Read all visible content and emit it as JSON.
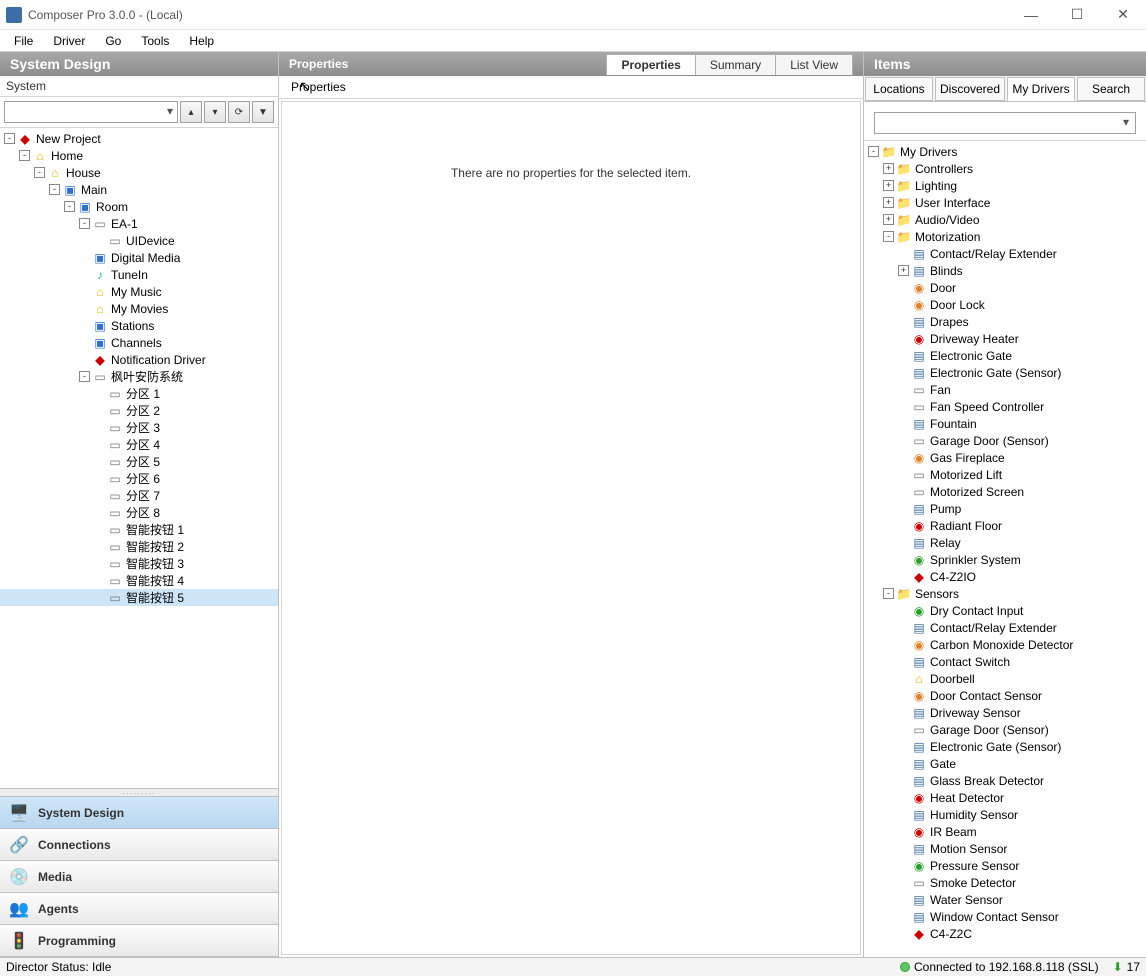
{
  "window": {
    "title": "Composer Pro 3.0.0 - (Local)"
  },
  "menu": {
    "file": "File",
    "driver": "Driver",
    "go": "Go",
    "tools": "Tools",
    "help": "Help"
  },
  "left_panel": {
    "title": "System Design",
    "system_label": "System",
    "tree": [
      {
        "depth": 0,
        "toggle": "-",
        "icon": "c4",
        "text": "New Project"
      },
      {
        "depth": 1,
        "toggle": "-",
        "icon": "yellow",
        "text": "Home"
      },
      {
        "depth": 2,
        "toggle": "-",
        "icon": "yellow",
        "text": "House"
      },
      {
        "depth": 3,
        "toggle": "-",
        "icon": "blue",
        "text": "Main"
      },
      {
        "depth": 4,
        "toggle": "-",
        "icon": "blue",
        "text": "Room"
      },
      {
        "depth": 5,
        "toggle": "-",
        "icon": "gray",
        "text": "EA-1"
      },
      {
        "depth": 6,
        "toggle": "",
        "icon": "gray",
        "text": "UIDevice"
      },
      {
        "depth": 5,
        "toggle": "",
        "icon": "blue",
        "text": "Digital Media"
      },
      {
        "depth": 5,
        "toggle": "",
        "icon": "cyan",
        "text": "TuneIn"
      },
      {
        "depth": 5,
        "toggle": "",
        "icon": "yellow",
        "text": "My Music"
      },
      {
        "depth": 5,
        "toggle": "",
        "icon": "yellow",
        "text": "My Movies"
      },
      {
        "depth": 5,
        "toggle": "",
        "icon": "blue",
        "text": "Stations"
      },
      {
        "depth": 5,
        "toggle": "",
        "icon": "blue",
        "text": "Channels"
      },
      {
        "depth": 5,
        "toggle": "",
        "icon": "c4",
        "text": "Notification Driver"
      },
      {
        "depth": 5,
        "toggle": "-",
        "icon": "gray",
        "text": "枫叶安防系统"
      },
      {
        "depth": 6,
        "toggle": "",
        "icon": "gray",
        "text": "分区 1"
      },
      {
        "depth": 6,
        "toggle": "",
        "icon": "gray",
        "text": "分区 2"
      },
      {
        "depth": 6,
        "toggle": "",
        "icon": "gray",
        "text": "分区 3"
      },
      {
        "depth": 6,
        "toggle": "",
        "icon": "gray",
        "text": "分区 4"
      },
      {
        "depth": 6,
        "toggle": "",
        "icon": "gray",
        "text": "分区 5"
      },
      {
        "depth": 6,
        "toggle": "",
        "icon": "gray",
        "text": "分区 6"
      },
      {
        "depth": 6,
        "toggle": "",
        "icon": "gray",
        "text": "分区 7"
      },
      {
        "depth": 6,
        "toggle": "",
        "icon": "gray",
        "text": "分区 8"
      },
      {
        "depth": 6,
        "toggle": "",
        "icon": "gray",
        "text": "智能按钮 1"
      },
      {
        "depth": 6,
        "toggle": "",
        "icon": "gray",
        "text": "智能按钮 2"
      },
      {
        "depth": 6,
        "toggle": "",
        "icon": "gray",
        "text": "智能按钮 3"
      },
      {
        "depth": 6,
        "toggle": "",
        "icon": "gray",
        "text": "智能按钮 4"
      },
      {
        "depth": 6,
        "toggle": "",
        "icon": "gray",
        "text": "智能按钮 5",
        "selected": true
      }
    ],
    "nav": {
      "system_design": "System Design",
      "connections": "Connections",
      "media": "Media",
      "agents": "Agents",
      "programming": "Programming"
    }
  },
  "center_panel": {
    "title": "Properties",
    "tabs": {
      "properties": "Properties",
      "summary": "Summary",
      "list_view": "List View"
    },
    "header_label": "Properties",
    "empty_text": "There are no properties for the selected item."
  },
  "right_panel": {
    "title": "Items",
    "tabs": {
      "locations": "Locations",
      "discovered": "Discovered",
      "my_drivers": "My Drivers",
      "search": "Search"
    },
    "tree": [
      {
        "depth": 0,
        "toggle": "-",
        "icon": "folder",
        "text": "My Drivers"
      },
      {
        "depth": 1,
        "toggle": "+",
        "icon": "folder",
        "text": "Controllers"
      },
      {
        "depth": 1,
        "toggle": "+",
        "icon": "folder",
        "text": "Lighting"
      },
      {
        "depth": 1,
        "toggle": "+",
        "icon": "folder",
        "text": "User Interface"
      },
      {
        "depth": 1,
        "toggle": "+",
        "icon": "folder",
        "text": "Audio/Video"
      },
      {
        "depth": 1,
        "toggle": "-",
        "icon": "folder",
        "text": "Motorization"
      },
      {
        "depth": 2,
        "toggle": "",
        "icon": "dev",
        "text": "Contact/Relay Extender"
      },
      {
        "depth": 2,
        "toggle": "+",
        "icon": "dev",
        "text": "Blinds"
      },
      {
        "depth": 2,
        "toggle": "",
        "icon": "orange",
        "text": "Door"
      },
      {
        "depth": 2,
        "toggle": "",
        "icon": "orange",
        "text": "Door Lock"
      },
      {
        "depth": 2,
        "toggle": "",
        "icon": "dev",
        "text": "Drapes"
      },
      {
        "depth": 2,
        "toggle": "",
        "icon": "red",
        "text": "Driveway Heater"
      },
      {
        "depth": 2,
        "toggle": "",
        "icon": "dev",
        "text": "Electronic Gate"
      },
      {
        "depth": 2,
        "toggle": "",
        "icon": "dev",
        "text": "Electronic Gate (Sensor)"
      },
      {
        "depth": 2,
        "toggle": "",
        "icon": "gray",
        "text": "Fan"
      },
      {
        "depth": 2,
        "toggle": "",
        "icon": "gray",
        "text": "Fan Speed Controller"
      },
      {
        "depth": 2,
        "toggle": "",
        "icon": "dev",
        "text": "Fountain"
      },
      {
        "depth": 2,
        "toggle": "",
        "icon": "gray",
        "text": "Garage Door (Sensor)"
      },
      {
        "depth": 2,
        "toggle": "",
        "icon": "orange",
        "text": "Gas Fireplace"
      },
      {
        "depth": 2,
        "toggle": "",
        "icon": "gray",
        "text": "Motorized Lift"
      },
      {
        "depth": 2,
        "toggle": "",
        "icon": "gray",
        "text": "Motorized Screen"
      },
      {
        "depth": 2,
        "toggle": "",
        "icon": "dev",
        "text": "Pump"
      },
      {
        "depth": 2,
        "toggle": "",
        "icon": "red",
        "text": "Radiant Floor"
      },
      {
        "depth": 2,
        "toggle": "",
        "icon": "dev",
        "text": "Relay"
      },
      {
        "depth": 2,
        "toggle": "",
        "icon": "green",
        "text": "Sprinkler System"
      },
      {
        "depth": 2,
        "toggle": "",
        "icon": "c4",
        "text": "C4-Z2IO"
      },
      {
        "depth": 1,
        "toggle": "-",
        "icon": "folder",
        "text": "Sensors"
      },
      {
        "depth": 2,
        "toggle": "",
        "icon": "green",
        "text": "Dry Contact Input"
      },
      {
        "depth": 2,
        "toggle": "",
        "icon": "dev",
        "text": "Contact/Relay Extender"
      },
      {
        "depth": 2,
        "toggle": "",
        "icon": "orange",
        "text": "Carbon Monoxide Detector"
      },
      {
        "depth": 2,
        "toggle": "",
        "icon": "dev",
        "text": "Contact Switch"
      },
      {
        "depth": 2,
        "toggle": "",
        "icon": "yellow",
        "text": "Doorbell"
      },
      {
        "depth": 2,
        "toggle": "",
        "icon": "orange",
        "text": "Door Contact Sensor"
      },
      {
        "depth": 2,
        "toggle": "",
        "icon": "dev",
        "text": "Driveway Sensor"
      },
      {
        "depth": 2,
        "toggle": "",
        "icon": "gray",
        "text": "Garage Door (Sensor)"
      },
      {
        "depth": 2,
        "toggle": "",
        "icon": "dev",
        "text": "Electronic Gate (Sensor)"
      },
      {
        "depth": 2,
        "toggle": "",
        "icon": "dev",
        "text": "Gate"
      },
      {
        "depth": 2,
        "toggle": "",
        "icon": "dev",
        "text": "Glass Break Detector"
      },
      {
        "depth": 2,
        "toggle": "",
        "icon": "red",
        "text": "Heat Detector"
      },
      {
        "depth": 2,
        "toggle": "",
        "icon": "dev",
        "text": "Humidity Sensor"
      },
      {
        "depth": 2,
        "toggle": "",
        "icon": "red",
        "text": "IR Beam"
      },
      {
        "depth": 2,
        "toggle": "",
        "icon": "dev",
        "text": "Motion Sensor"
      },
      {
        "depth": 2,
        "toggle": "",
        "icon": "green",
        "text": "Pressure Sensor"
      },
      {
        "depth": 2,
        "toggle": "",
        "icon": "gray",
        "text": "Smoke Detector"
      },
      {
        "depth": 2,
        "toggle": "",
        "icon": "dev",
        "text": "Water Sensor"
      },
      {
        "depth": 2,
        "toggle": "",
        "icon": "dev",
        "text": "Window Contact Sensor"
      },
      {
        "depth": 2,
        "toggle": "",
        "icon": "c4",
        "text": "C4-Z2C"
      }
    ]
  },
  "status": {
    "director": "Director Status:  Idle",
    "connected": "Connected to 192.168.8.118 (SSL)",
    "download_count": "17"
  }
}
